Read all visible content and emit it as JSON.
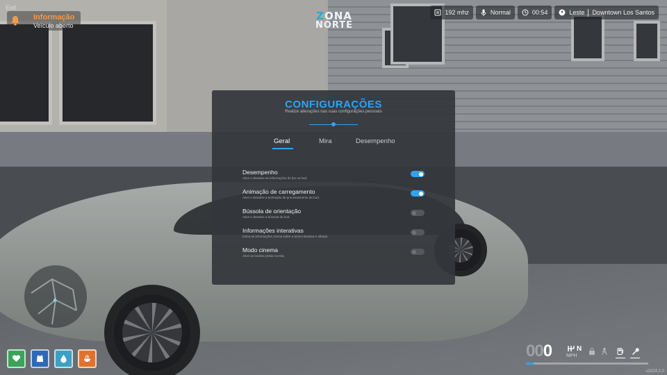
{
  "top_label": "Exit",
  "notification": {
    "title": "Informação",
    "message": "Veículo aberto",
    "icon": "bell-icon",
    "accent": "#f39a4a"
  },
  "logo": {
    "line1_a": "Z",
    "line1_b": "ONA",
    "line2": "NORTE"
  },
  "status_bar": {
    "radio": "192 mhz",
    "voice": "Normal",
    "time": "00:54",
    "direction": "Leste",
    "location": "Downtown Los Santos"
  },
  "settings": {
    "title": "CONFIGURAÇÕES",
    "subtitle": "Realize alterações nas suas configurações pessoais",
    "accent": "#2ea3f2",
    "tabs": [
      {
        "label": "Geral",
        "active": true
      },
      {
        "label": "Mira",
        "active": false
      },
      {
        "label": "Desempenho",
        "active": false
      }
    ],
    "options": [
      {
        "label": "Desempenho",
        "description": "Ative e desative as informações de fps na hud.",
        "enabled": true
      },
      {
        "label": "Animação de carregamento",
        "description": "Ative e desative a animação de processamento da hud.",
        "enabled": true
      },
      {
        "label": "Bússola de orientação",
        "description": "Ative e desative a bússola da hud.",
        "enabled": false
      },
      {
        "label": "Informações interativas",
        "description": "Exiba as informações cinzas sobre a tecla interativa e olhada.",
        "enabled": false
      },
      {
        "label": "Modo cinema",
        "description": "Ative as bordas pretas na tela.",
        "enabled": false
      }
    ]
  },
  "stats": [
    {
      "name": "health",
      "icon": "heart-icon",
      "color": "#3aa35a"
    },
    {
      "name": "armor",
      "icon": "vest-icon",
      "color": "#2f69b5"
    },
    {
      "name": "thirst",
      "icon": "water-drop-icon",
      "color": "#3d9fc4"
    },
    {
      "name": "hunger",
      "icon": "food-icon",
      "color": "#e0722e"
    }
  ],
  "vehicle": {
    "speed_ghost": "00",
    "speed_value": "0",
    "gear": "N",
    "unit": "MPH",
    "speed_fraction": 0.06
  },
  "version": "v2024.2.0"
}
